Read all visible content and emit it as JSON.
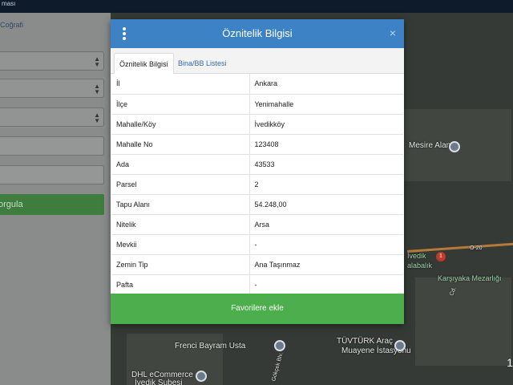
{
  "topbar": {
    "text": "ması"
  },
  "sidebar": {
    "crumb": "Coğrafi",
    "query_button": "orgula"
  },
  "map": {
    "labels": {
      "mesire": "Mesire Alanı",
      "ivedik": "İvedik",
      "balik": "alabalık",
      "karsiyaka": "Karşıyaka Mezarlığı",
      "cd": "Cd.",
      "frenci": "Frenci Bayram Usta",
      "tuvturk": "TÜVTÜRK Araç",
      "muayene": "Muayene İstasyonu",
      "dhl": "DHL eCommerce",
      "ivedik_sube": "İvedik Şubesi",
      "road_code": "O-20",
      "gokcek": "Gökçek Blv."
    },
    "corner_number": "1"
  },
  "modal": {
    "title": "Öznitelik Bilgisi",
    "close": "×",
    "tabs": [
      {
        "label": "Öznitelik Bilgisi",
        "active": true
      },
      {
        "label": "Bina/BB Listesi",
        "active": false
      }
    ],
    "rows": [
      {
        "key": "İl",
        "value": "Ankara"
      },
      {
        "key": "İlçe",
        "value": "Yenimahalle"
      },
      {
        "key": "Mahalle/Köy",
        "value": "İvedikköy"
      },
      {
        "key": "Mahalle No",
        "value": "123408"
      },
      {
        "key": "Ada",
        "value": "43533"
      },
      {
        "key": "Parsel",
        "value": "2"
      },
      {
        "key": "Tapu Alanı",
        "value": "54.248,00"
      },
      {
        "key": "Nitelik",
        "value": "Arsa"
      },
      {
        "key": "Mevkii",
        "value": "-"
      },
      {
        "key": "Zemin Tip",
        "value": "Ana Taşınmaz"
      },
      {
        "key": "Pafta",
        "value": "-"
      }
    ],
    "favorite_button": "Favorilere ekle"
  },
  "colors": {
    "header_blue": "#3d82c4",
    "favorite_green": "#4cae4c",
    "tab_link_blue": "#2d6fb0"
  }
}
